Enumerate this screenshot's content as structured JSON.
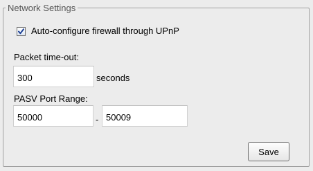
{
  "network_settings": {
    "title": "Network Settings",
    "upnp": {
      "label": "Auto-configure firewall through UPnP",
      "checked": true
    },
    "packet_timeout": {
      "label": "Packet time-out:",
      "value": "300",
      "unit": "seconds"
    },
    "pasv_port_range": {
      "label": "PASV Port Range:",
      "start": "50000",
      "separator": "-",
      "end": "50009"
    },
    "save_label": "Save"
  },
  "colors": {
    "panel_background": "#ececec",
    "border": "#a0a0a0",
    "checkmark": "#1c3f94"
  },
  "icons": {
    "checkbox_checked": "checkmark-icon"
  }
}
